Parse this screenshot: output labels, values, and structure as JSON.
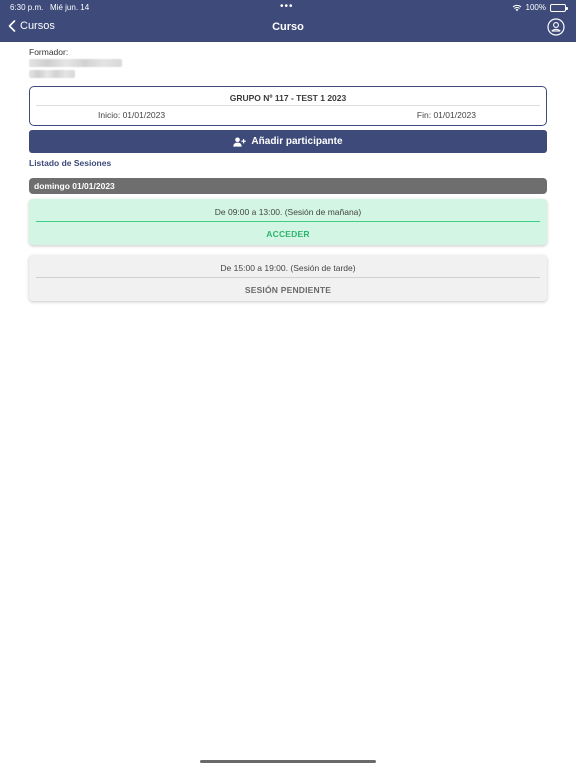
{
  "status_bar": {
    "time": "6:30 p.m.",
    "date": "Mié jun. 14",
    "dots": "•••",
    "battery": "100%"
  },
  "nav": {
    "back_label": "Cursos",
    "title": "Curso",
    "profile_icon": "user-circle-icon"
  },
  "trainer": {
    "label": "Formador:"
  },
  "group": {
    "title": "GRUPO Nº 117 - TEST 1 2023",
    "start": "Inicio: 01/01/2023",
    "end": "Fin: 01/01/2023"
  },
  "add_participant": {
    "label": "Añadir participante",
    "icon": "user-plus-icon"
  },
  "sessions": {
    "heading": "Listado de Sesiones",
    "day": "domingo 01/01/2023",
    "items": [
      {
        "time": "De 09:00 a 13:00. (Sesión de mañana)",
        "action": "ACCEDER"
      },
      {
        "time": "De 15:00 a 19:00. (Sesión de tarde)",
        "action": "SESIÓN PENDIENTE"
      }
    ]
  },
  "colors": {
    "primary": "#3d4a7a",
    "active_session_bg": "#d2f6e3",
    "active_action": "#2db570",
    "pending_session_bg": "#f1f1f1",
    "day_header": "#6e6e6e"
  }
}
